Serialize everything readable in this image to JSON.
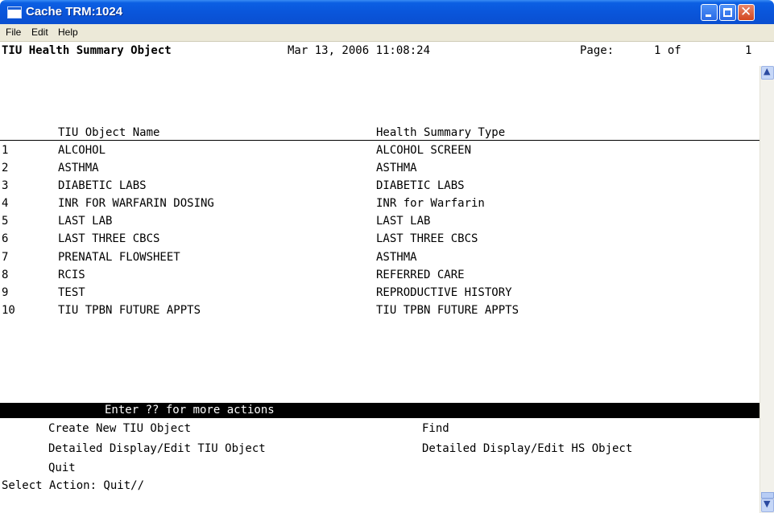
{
  "window": {
    "title": "Cache TRM:1024"
  },
  "menu": [
    "File",
    "Edit",
    "Help"
  ],
  "header": {
    "title": "TIU Health Summary Object",
    "datetime": "Mar 13, 2006 11:08:24",
    "page_label": "Page:",
    "page_num": "1 of",
    "page_total": "1"
  },
  "columns": {
    "name": "TIU Object Name",
    "type": "Health Summary Type"
  },
  "rows": [
    {
      "num": "1",
      "name": "ALCOHOL",
      "type": "ALCOHOL SCREEN"
    },
    {
      "num": "2",
      "name": "ASTHMA",
      "type": "ASTHMA"
    },
    {
      "num": "3",
      "name": "DIABETIC LABS",
      "type": "DIABETIC LABS"
    },
    {
      "num": "4",
      "name": "INR FOR WARFARIN DOSING",
      "type": "INR for Warfarin"
    },
    {
      "num": "5",
      "name": "LAST LAB",
      "type": "LAST LAB"
    },
    {
      "num": "6",
      "name": "LAST THREE CBCS",
      "type": "LAST THREE CBCS"
    },
    {
      "num": "7",
      "name": "PRENATAL FLOWSHEET",
      "type": "ASTHMA"
    },
    {
      "num": "8",
      "name": "RCIS",
      "type": "REFERRED CARE"
    },
    {
      "num": "9",
      "name": "TEST",
      "type": "REPRODUCTIVE HISTORY"
    },
    {
      "num": "10",
      "name": "TIU TPBN FUTURE APPTS",
      "type": "TIU TPBN FUTURE APPTS"
    }
  ],
  "action_hint": "Enter ?? for more actions",
  "actions": {
    "create": "Create New TIU Object",
    "find": "Find",
    "detailed_tiu": "Detailed Display/Edit TIU Object",
    "detailed_hs": "Detailed Display/Edit HS Object",
    "quit": "Quit"
  },
  "prompt": "Select Action: Quit//",
  "icons": {
    "scroll_up": "scroll-up-arrow-icon",
    "scroll_down": "scroll-down-arrow-icon"
  }
}
